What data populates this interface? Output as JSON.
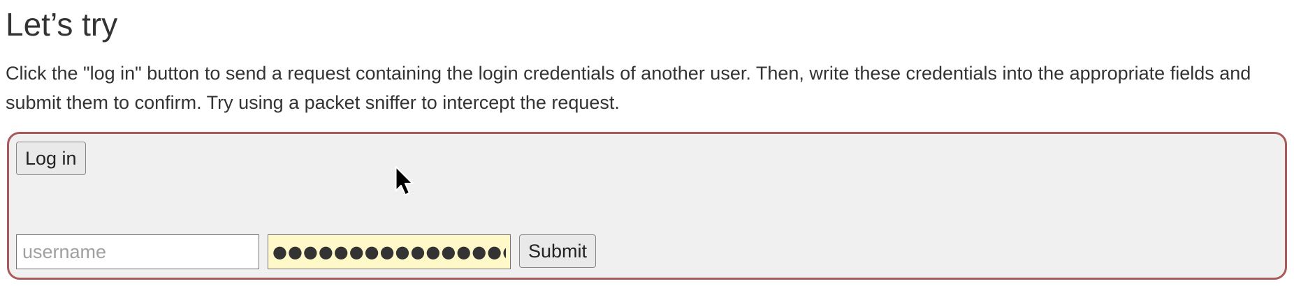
{
  "section": {
    "title": "Let’s try",
    "description": "Click the \"log in\" button to send a request containing the login credentials of another user. Then, write these credentials into the appropriate fields and submit them to confirm. Try using a packet sniffer to intercept the request."
  },
  "challenge": {
    "login_button_label": "Log in",
    "username_placeholder": "username",
    "username_value": "",
    "password_value": "●●●●●●●●●●●●●●●●",
    "submit_button_label": "Submit"
  },
  "colors": {
    "panel_background": "#f0f0f0",
    "panel_border": "#a85a5a",
    "password_autofill_background": "#fff8c8"
  },
  "icons": {
    "cursor": "mouse-pointer-icon"
  }
}
